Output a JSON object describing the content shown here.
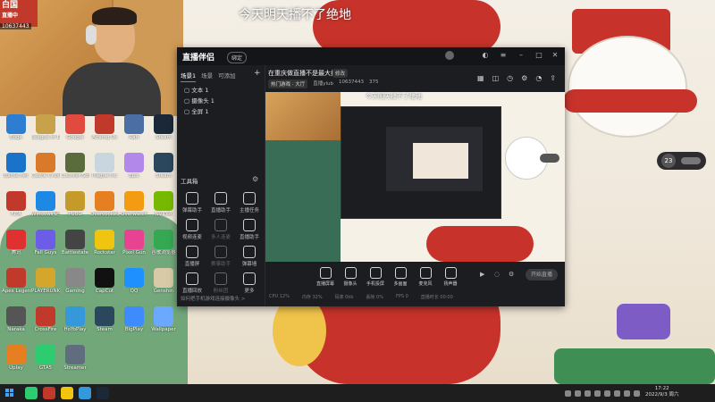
{
  "webcam": {
    "logo_text": "白国",
    "logo_sub": "直播中",
    "viewer_count": "10637443"
  },
  "stream_title": "今天明天播不了绝地",
  "desktop_icons": [
    {
      "label": "Edge",
      "color": "#2d7dd2"
    },
    {
      "label": "League of Legends",
      "color": "#c8a24b"
    },
    {
      "label": "Google",
      "color": "#e04a3f"
    },
    {
      "label": "Among Us",
      "color": "#c0392b"
    },
    {
      "label": "Raft",
      "color": "#4b6fa5"
    },
    {
      "label": "Steam",
      "color": "#1b2838"
    },
    {
      "label": "Battle.net",
      "color": "#1a73c9"
    },
    {
      "label": "Castle Crush",
      "color": "#d97a2b"
    },
    {
      "label": "Counter-Strike",
      "color": "#5a6b3c"
    },
    {
      "label": "Plague Inc",
      "color": "#c9d6e0"
    },
    {
      "label": "Epic",
      "color": "#b388eb"
    },
    {
      "label": "Steam",
      "color": "#2a475e"
    },
    {
      "label": "FIFA",
      "color": "#c0392b"
    },
    {
      "label": "Windows安全",
      "color": "#1e88e5"
    },
    {
      "label": "PUBG",
      "color": "#c49a2a"
    },
    {
      "label": "Overcooked",
      "color": "#e67e22"
    },
    {
      "label": "Overwatch",
      "color": "#f39c12"
    },
    {
      "label": "NVIDIA",
      "color": "#76b900"
    },
    {
      "label": "腾讯",
      "color": "#e03131"
    },
    {
      "label": "Fall Guys",
      "color": "#6c5ce7"
    },
    {
      "label": "Battlestate",
      "color": "#444444"
    },
    {
      "label": "Rockstar",
      "color": "#f1c40f"
    },
    {
      "label": "Pixel Gun",
      "color": "#e84393"
    },
    {
      "label": "谷歌浏览器",
      "color": "#34a853"
    },
    {
      "label": "Apex Legends",
      "color": "#c0392b"
    },
    {
      "label": "PLAYERUNKNOWN",
      "color": "#d4a72c"
    },
    {
      "label": "Gaming",
      "color": "#888888"
    },
    {
      "label": "CapCut",
      "color": "#111111"
    },
    {
      "label": "QQ",
      "color": "#1e90ff"
    },
    {
      "label": "Genshin",
      "color": "#d8c9a7"
    },
    {
      "label": "Naraka",
      "color": "#555555"
    },
    {
      "label": "CrossFire",
      "color": "#c0392b"
    },
    {
      "label": "HoYoPlay",
      "color": "#3498db"
    },
    {
      "label": "Steam",
      "color": "#2a475e"
    },
    {
      "label": "BigPlay",
      "color": "#3d8bfd"
    },
    {
      "label": "Wallpaper",
      "color": "#6aa9ff"
    },
    {
      "label": "Uplay",
      "color": "#e67e22"
    },
    {
      "label": "GTA5",
      "color": "#2ecc71"
    },
    {
      "label": "Streamer",
      "color": "#5f6d7e"
    }
  ],
  "app": {
    "logo": "直播伴侣",
    "badge": "绑定",
    "tabs": [
      "场景1",
      "场景",
      "可添加"
    ],
    "scenes": [
      "文本 1",
      "摄像头 1",
      "全屏 1"
    ],
    "tools_title": "工具箱",
    "tools": [
      {
        "label": "弹幕助手",
        "dim": false
      },
      {
        "label": "直播助手",
        "dim": false
      },
      {
        "label": "主播任务",
        "dim": false
      },
      {
        "label": "视频连麦",
        "dim": false
      },
      {
        "label": "多人连麦",
        "dim": true
      },
      {
        "label": "直播助手",
        "dim": false
      },
      {
        "label": "直播屏",
        "dim": false
      },
      {
        "label": "赛事助手",
        "dim": true
      },
      {
        "label": "弹幕墙",
        "dim": false
      },
      {
        "label": "直播回放",
        "dim": false
      },
      {
        "label": "粉丝团",
        "dim": true
      },
      {
        "label": "更多",
        "dim": false
      }
    ],
    "left_footer": "如何把手机游戏连接摄像头 >",
    "room_title": "在重庆做直播不是最大搞",
    "edit_label": "修改",
    "room_category": "热门游戏 · 大厅",
    "room_user": "直播ylub",
    "room_id": "10637443",
    "room_fans": "375",
    "top_icons": [
      "grid",
      "bag",
      "clock",
      "gear",
      "bell",
      "share"
    ],
    "preview_title": "今天明天播不了绝地",
    "bottom_tools": [
      "直播屏幕",
      "摄像头",
      "手机投屏",
      "多画面",
      "麦克风",
      "扬声器"
    ],
    "start_label": "开始直播",
    "status": [
      "CPU 12%",
      "内存 32%",
      "码率 0kb",
      "丢帧 0%",
      "FPS 0",
      "直播时长 00:00"
    ]
  },
  "notify": {
    "count": "23"
  },
  "taskbar": {
    "apps": [
      {
        "color": "#2ecc71"
      },
      {
        "color": "#c0392b"
      },
      {
        "color": "#f1c40f"
      },
      {
        "color": "#3498db"
      },
      {
        "color": "#1b2838"
      }
    ],
    "time": "17:22",
    "date": "2022/9/3 周六"
  }
}
